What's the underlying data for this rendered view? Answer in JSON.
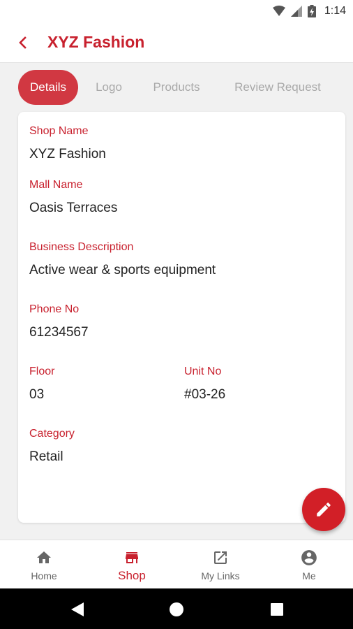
{
  "status_bar": {
    "time": "1:14"
  },
  "app_bar": {
    "title": "XYZ Fashion"
  },
  "tabs": [
    {
      "label": "Details",
      "active": true
    },
    {
      "label": "Logo",
      "active": false
    },
    {
      "label": "Products",
      "active": false
    },
    {
      "label": "Review Request",
      "active": false
    }
  ],
  "details": {
    "shop_name": {
      "label": "Shop Name",
      "value": "XYZ Fashion"
    },
    "mall_name": {
      "label": "Mall Name",
      "value": "Oasis Terraces"
    },
    "business_description": {
      "label": "Business Description",
      "value": "Active wear & sports equipment"
    },
    "phone_no": {
      "label": "Phone No",
      "value": "61234567"
    },
    "floor": {
      "label": "Floor",
      "value": "03"
    },
    "unit_no": {
      "label": "Unit No",
      "value": "#03-26"
    },
    "category": {
      "label": "Category",
      "value": "Retail"
    }
  },
  "bottom_nav": [
    {
      "label": "Home",
      "icon": "home-icon"
    },
    {
      "label": "Shop",
      "icon": "store-icon",
      "active": true
    },
    {
      "label": "My Links",
      "icon": "external-link-icon"
    },
    {
      "label": "Me",
      "icon": "account-circle-icon"
    }
  ],
  "colors": {
    "accent": "#c8212e",
    "fab": "#d21f27",
    "tab_active": "#d13842"
  }
}
